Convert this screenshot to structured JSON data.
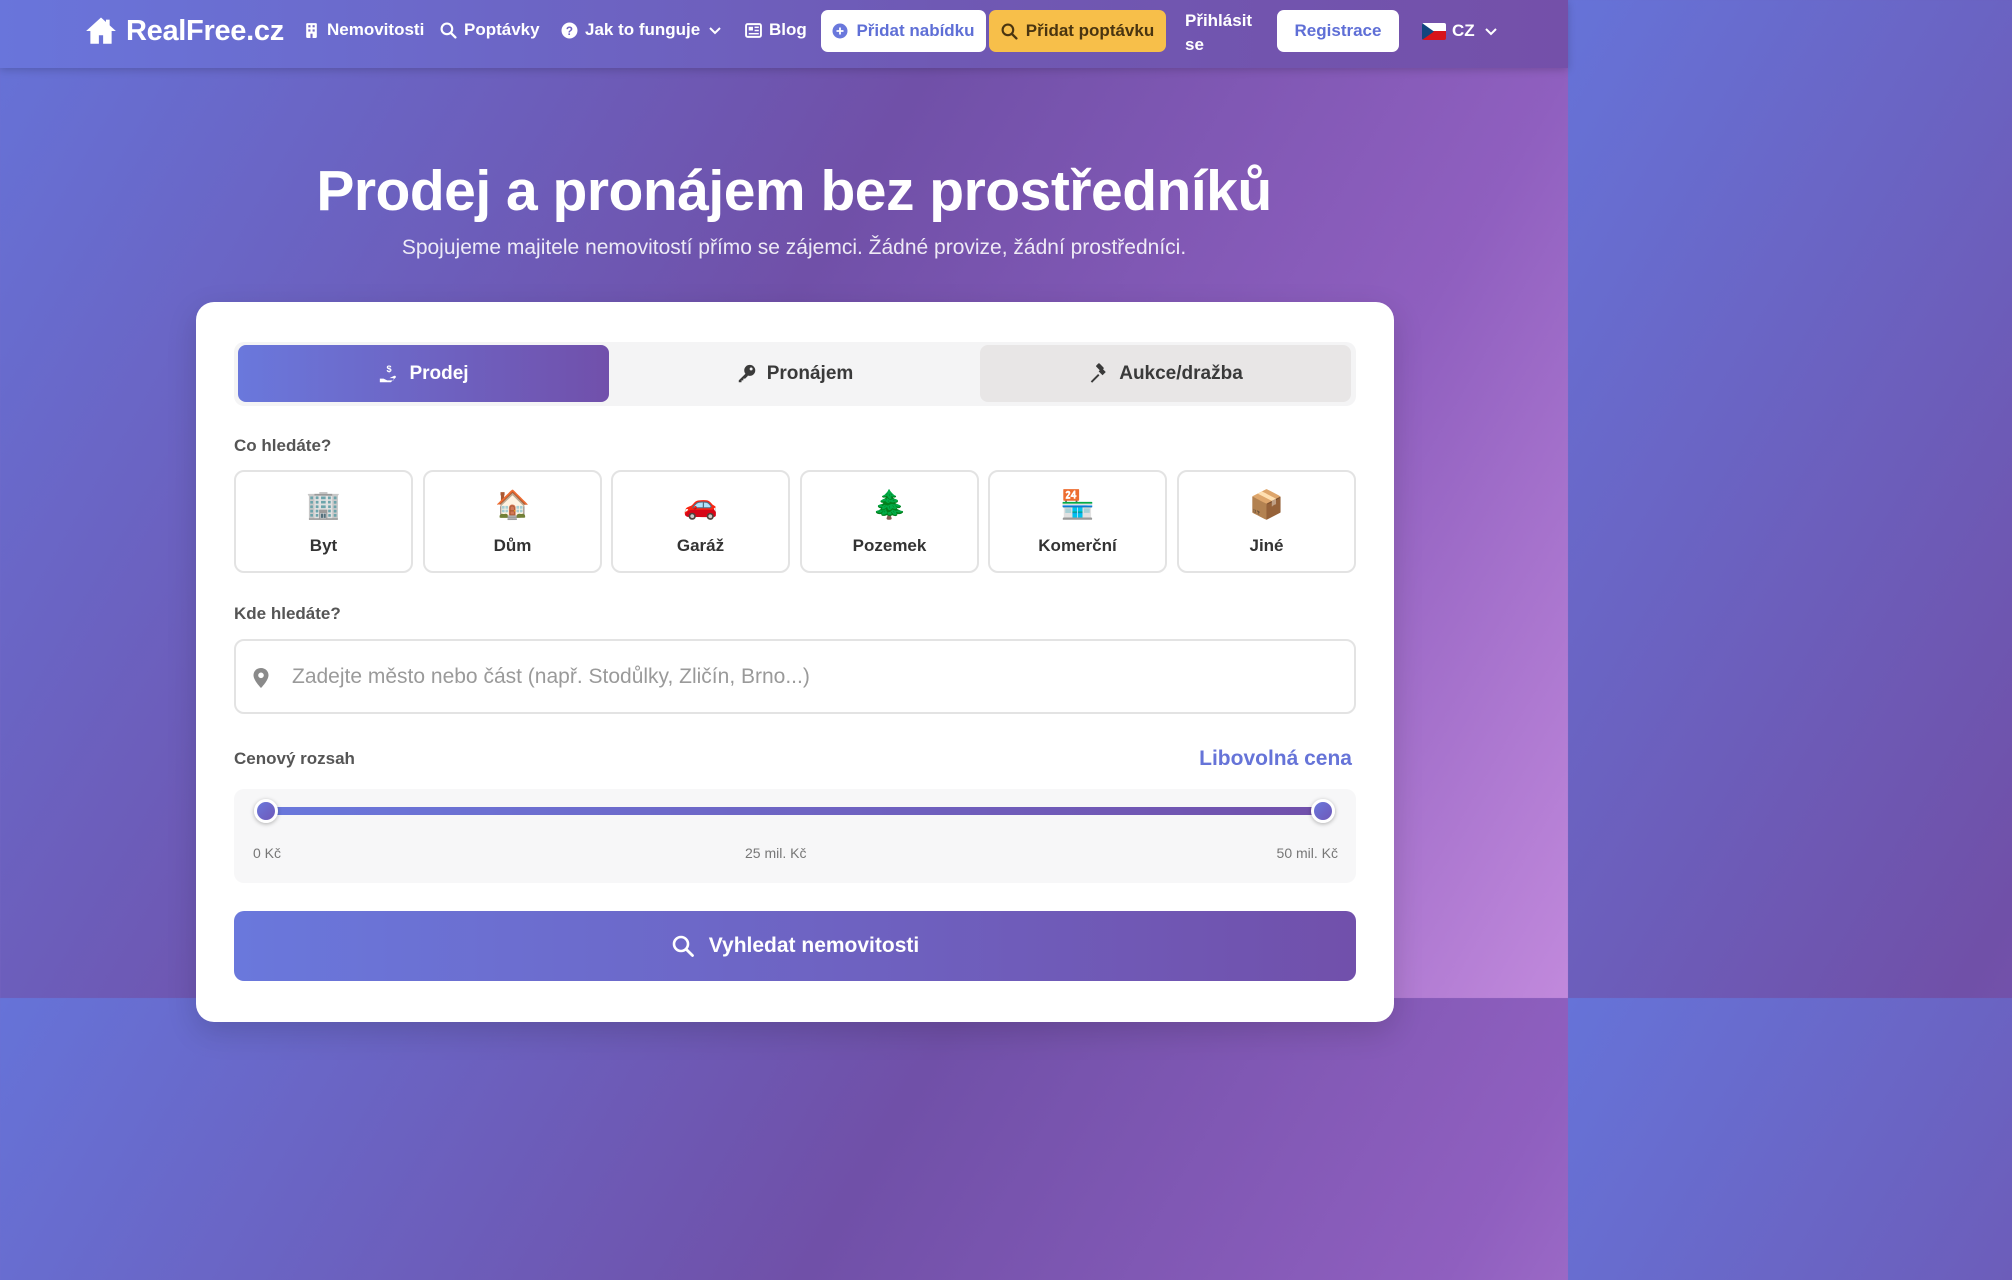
{
  "nav": {
    "logo": "RealFree.cz",
    "links": {
      "properties": "Nemovitosti",
      "demands": "Poptávky",
      "how_it_works": "Jak to funguje",
      "blog": "Blog"
    },
    "add_offer": "Přidat nabídku",
    "add_demand": "Přidat poptávku",
    "login": "Přihlásit se",
    "register": "Registrace",
    "language": "CZ"
  },
  "hero": {
    "title": "Prodej a pronájem bez prostředníků",
    "subtitle": "Spojujeme majitele nemovitostí přímo se zájemci. Žádné provize, žádní prostředníci."
  },
  "search": {
    "tabs": [
      "Prodej",
      "Pronájem",
      "Aukce/dražba"
    ],
    "active_tab": "Prodej",
    "type_label": "Co hledáte?",
    "types": [
      {
        "emoji": "🏢",
        "name": "Byt"
      },
      {
        "emoji": "🏠",
        "name": "Dům"
      },
      {
        "emoji": "🚗",
        "name": "Garáž"
      },
      {
        "emoji": "🌲",
        "name": "Pozemek"
      },
      {
        "emoji": "🏪",
        "name": "Komerční"
      },
      {
        "emoji": "📦",
        "name": "Jiné"
      }
    ],
    "location_label": "Kde hledáte?",
    "location_placeholder": "Zadejte město nebo část (např. Stodůlky, Zličín, Brno...)",
    "location_value": "",
    "price_label": "Cenový rozsah",
    "price_value": "Libovolná cena",
    "price_ticks": [
      "0 Kč",
      "25 mil. Kč",
      "50 mil. Kč"
    ],
    "price_min_fraction": 0,
    "price_max_fraction": 1,
    "submit": "Vyhledat nemovitosti"
  },
  "colors": {
    "accent": "#6a78dc",
    "accent_dark": "#7150ab",
    "demand_button": "#f7bf4a",
    "price_text": "#6674d8"
  }
}
